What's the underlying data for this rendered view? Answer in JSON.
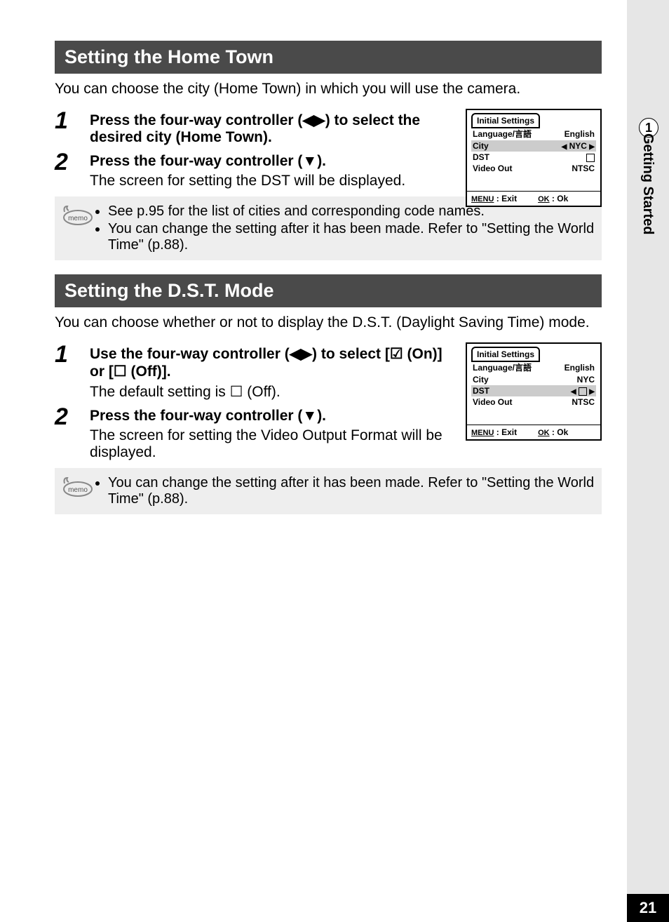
{
  "sidebar": {
    "chapter_number": "1",
    "chapter_title": "Getting Started",
    "page_number": "21"
  },
  "section1": {
    "title": "Setting the Home Town",
    "intro": "You can choose the city (Home Town) in which you will use the camera.",
    "step1": {
      "num": "1",
      "text": "Press the four-way controller (◀▶) to select the desired city (Home Town)."
    },
    "step2": {
      "num": "2",
      "bold": "Press the four-way controller (▼).",
      "desc": "The screen for setting the DST will be displayed."
    },
    "memo1": "See p.95 for the list of cities and corresponding code names.",
    "memo2": "You can change the setting after it has been made. Refer to \"Setting the World Time\" (p.88)."
  },
  "lcd1": {
    "title": "Initial Settings",
    "language_label": "Language/言語",
    "language_value": "English",
    "city_label": "City",
    "city_value": "NYC",
    "dst_label": "DST",
    "video_label": "Video Out",
    "video_value": "NTSC",
    "menu": "MENU",
    "exit": "Exit",
    "ok": "OK",
    "ok_action": "Ok"
  },
  "section2": {
    "title": "Setting the D.S.T. Mode",
    "intro": "You can choose whether or not to display the D.S.T. (Daylight Saving Time) mode.",
    "step1": {
      "num": "1",
      "bold": "Use the four-way controller (◀▶) to select [☑ (On)] or [☐ (Off)].",
      "desc": "The default setting is ☐ (Off)."
    },
    "step2": {
      "num": "2",
      "bold": "Press the four-way controller (▼).",
      "desc": "The screen for setting the Video Output Format will be displayed."
    },
    "memo1": "You can change the setting after it has been made. Refer to \"Setting the World Time\" (p.88)."
  },
  "lcd2": {
    "title": "Initial Settings",
    "language_label": "Language/言語",
    "language_value": "English",
    "city_label": "City",
    "city_value": "NYC",
    "dst_label": "DST",
    "video_label": "Video Out",
    "video_value": "NTSC",
    "menu": "MENU",
    "exit": "Exit",
    "ok": "OK",
    "ok_action": "Ok"
  }
}
